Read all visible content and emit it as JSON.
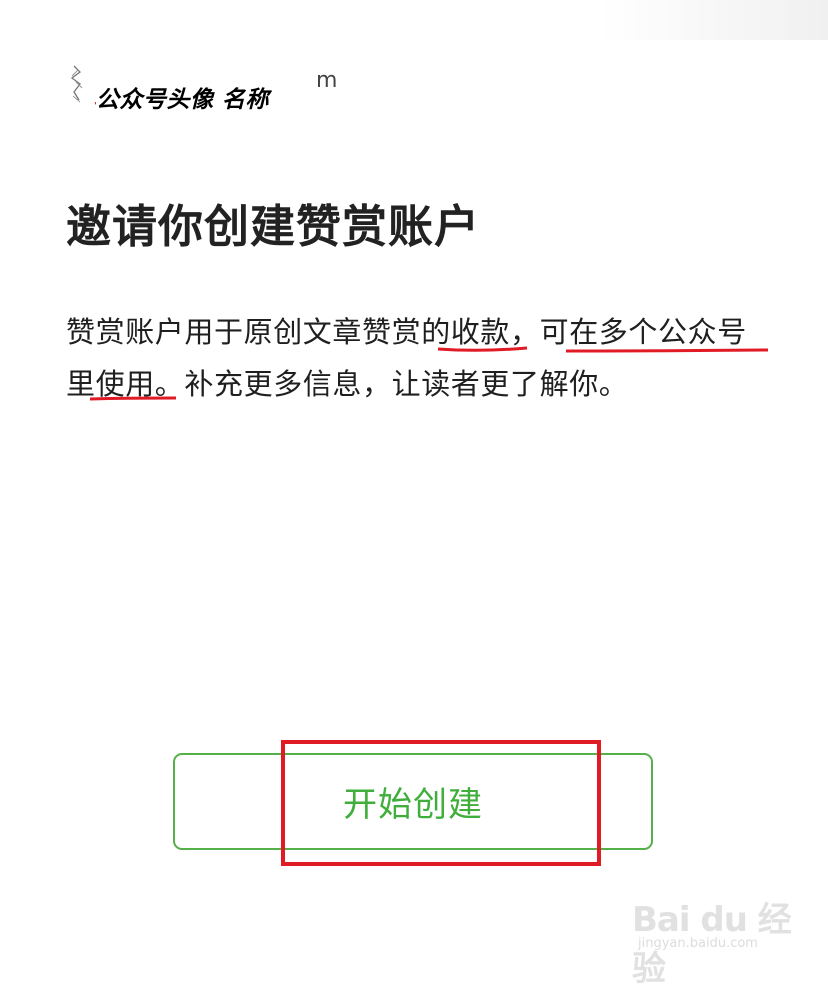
{
  "header": {
    "name": "公众号头像 名称",
    "tail_glyph": "m"
  },
  "title": "邀请你创建赞赏账户",
  "description": "赞赏账户用于原创文章赞赏的收款，可在多个公众号里使用。补充更多信息，让读者更了解你。",
  "button": {
    "label": "开始创建"
  },
  "watermark": {
    "logo_text": "Bai du 经验",
    "url": "jingyan.baidu.com"
  },
  "colors": {
    "accent_green": "#3fae3b",
    "annotation_red": "#e01b26"
  }
}
